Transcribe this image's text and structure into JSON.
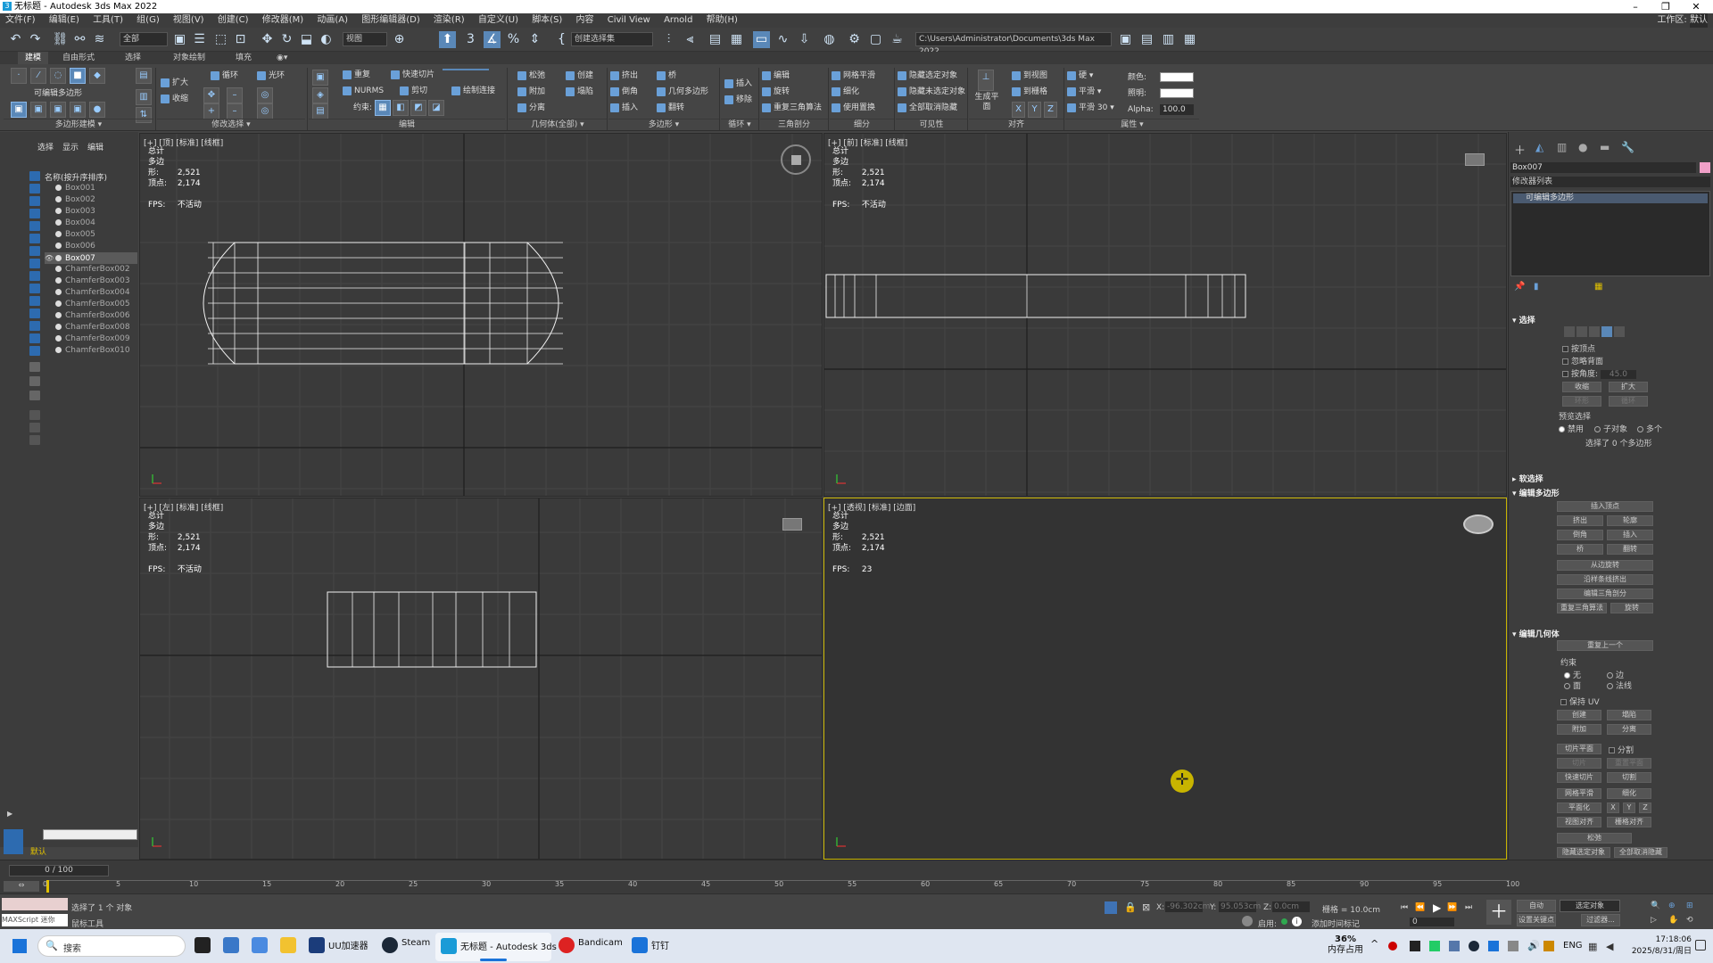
{
  "titlebar": {
    "title": "无标题 - Autodesk 3ds Max 2022",
    "logo": "3"
  },
  "menubar": {
    "items": [
      "文件(F)",
      "编辑(E)",
      "工具(T)",
      "组(G)",
      "视图(V)",
      "创建(C)",
      "修改器(M)",
      "动画(A)",
      "图形编辑器(D)",
      "渲染(R)",
      "自定义(U)",
      "脚本(S)",
      "内容",
      "Civil View",
      "Arnold",
      "帮助(H)"
    ],
    "workspace_label": "工作区:",
    "workspace_value": "默认"
  },
  "toolbar": {
    "filter": "全部",
    "view": "视图",
    "selection_set": "创建选择集",
    "project_path": "C:\\Users\\Administrator\\Documents\\3ds Max 2022"
  },
  "ribbon": {
    "tabs": [
      "建模",
      "自由形式",
      "选择",
      "对象绘制",
      "填充"
    ],
    "active_tab": "建模",
    "groups": [
      "多边形建模",
      "修改选择",
      "编辑",
      "几何体(全部)",
      "多边形",
      "循环",
      "三角剖分",
      "细分",
      "可见性",
      "对齐",
      "属性"
    ],
    "labels": {
      "editable_poly": "可编辑多边形",
      "grow": "扩大",
      "shrink": "收缩",
      "loop": "循环",
      "ring": "光环",
      "repeat": "重复",
      "quickslice": "快速切片",
      "nurms": "NURMS",
      "cut": "剪切",
      "constraint": "约束:",
      "swiftloop": "绘制连接",
      "relax": "松弛",
      "create": "创建",
      "attach": "附加",
      "collapse": "塌陷",
      "detach": "分离",
      "extrude": "挤出",
      "bridge": "桥",
      "chamfer": "倒角",
      "geopoly": "几何多边形",
      "inset": "插入",
      "flip": "翻转",
      "insert": "插入",
      "remove": "移除",
      "edit": "编辑",
      "rotate": "旋转",
      "retriangulate": "重复三角算法",
      "meshsmooth": "网格平滑",
      "tessellate": "细化",
      "usedisp": "使用置换",
      "hide_sel": "隐藏选定对象",
      "hide_unsel": "隐藏未选定对象",
      "unhide_all": "全部取消隐藏",
      "make_planar": "生成平面",
      "to_view": "到视图",
      "to_grid": "到栅格",
      "x": "X",
      "y": "Y",
      "z": "Z",
      "hard": "硬",
      "smooth": "平滑",
      "smooth30": "平滑 30",
      "color": "颜色:",
      "illum": "照明:",
      "alpha": "Alpha:",
      "alpha_val": "100.0"
    }
  },
  "scene_explorer": {
    "tabs": [
      "选择",
      "显示",
      "编辑"
    ],
    "column_header": "名称(按升序排序)",
    "objects": [
      "Box001",
      "Box002",
      "Box003",
      "Box004",
      "Box005",
      "Box006",
      "Box007",
      "ChamferBox002",
      "ChamferBox003",
      "ChamferBox004",
      "ChamferBox005",
      "ChamferBox006",
      "ChamferBox008",
      "ChamferBox009",
      "ChamferBox010"
    ],
    "selected": "Box007",
    "layer": "默认"
  },
  "viewports": {
    "top": {
      "label": "[+] [顶] [标准] [线框]",
      "fps_value": "不活动"
    },
    "front": {
      "label": "[+] [前] [标准] [线框]",
      "fps_value": "不活动"
    },
    "left": {
      "label": "[+] [左] [标准] [线框]",
      "fps_value": "不活动"
    },
    "persp": {
      "label": "[+] [透视] [标准] [边面]",
      "fps_value": "23"
    },
    "stats": {
      "total": "总计",
      "poly_label": "多边形:",
      "poly_value": "2,521",
      "vert_label": "顶点:",
      "vert_value": "2,174",
      "fps_label": "FPS:"
    }
  },
  "command_panel": {
    "object_name": "Box007",
    "modifier_list": "修改器列表",
    "stack_item": "可编辑多边形",
    "selection": {
      "title": "选择",
      "by_vertex": "按顶点",
      "ignore_back": "忽略背面",
      "by_angle": "按角度:",
      "angle_val": "45.0",
      "shrink": "收缩",
      "grow": "扩大",
      "ring": "环形",
      "loop": "循环",
      "preview": "预览选择",
      "off": "禁用",
      "subobj": "子对象",
      "multi": "多个",
      "status": "选择了 0 个多边形"
    },
    "soft_selection": "软选择",
    "edit_polygons": {
      "title": "编辑多边形",
      "insert_vertex": "插入顶点",
      "extrude": "挤出",
      "outline": "轮廓",
      "bevel": "倒角",
      "inset": "插入",
      "bridge": "桥",
      "flip": "翻转",
      "hinge": "从边旋转",
      "extrude_spline": "沿样条线挤出",
      "edit_tri": "编辑三角剖分",
      "retri": "重复三角算法",
      "turn": "旋转"
    },
    "edit_geometry": {
      "title": "编辑几何体",
      "repeat_last": "重复上一个",
      "constraints": "约束",
      "none": "无",
      "edge": "边",
      "face": "面",
      "normal": "法线",
      "preserve_uv": "保持 UV",
      "create": "创建",
      "collapse": "塌陷",
      "attach": "附加",
      "detach": "分离",
      "slice_plane": "切片平面",
      "split": "分割",
      "slice": "切片",
      "reset_plane": "重置平面",
      "quickslice": "快速切片",
      "cut": "切割",
      "meshsmooth": "网格平滑",
      "tessellate": "细化",
      "make_planar": "平面化",
      "x": "X",
      "y": "Y",
      "z": "Z",
      "view_align": "视图对齐",
      "grid_align": "栅格对齐",
      "relax": "松弛",
      "hide_sel": "隐藏选定对象",
      "unhide_all": "全部取消隐藏"
    }
  },
  "timeline": {
    "frame": "0 / 100",
    "ticks": [
      "0",
      "5",
      "10",
      "15",
      "20",
      "25",
      "30",
      "35",
      "40",
      "45",
      "50",
      "55",
      "60",
      "65",
      "70",
      "75",
      "80",
      "85",
      "90",
      "95",
      "100"
    ]
  },
  "status": {
    "maxscript": "MAXScript 迷你",
    "selected": "选择了 1 个 对象",
    "prompt": "鼠标工具",
    "x_label": "X:",
    "x_value": "-96.302cm",
    "y_label": "Y:",
    "y_value": "95.053cm",
    "z_label": "Z:",
    "z_value": "0.0cm",
    "grid": "栅格 = 10.0cm",
    "autokey": "自动",
    "setkey": "设置关键点",
    "sel_obj": "选定对象",
    "key_filter": "过滤器...",
    "enable": "启用:",
    "add_time_tag": "添加时间标记",
    "frame_val": "0"
  },
  "taskbar": {
    "search": "搜索",
    "apps": [
      "UU加速器",
      "Steam",
      "无标题 - Autodesk 3ds M",
      "Bandicam",
      "钉钉"
    ],
    "memory_pct": "36%",
    "memory_label": "内存占用",
    "lang": "ENG",
    "time": "17:18:06",
    "date": "2025/8/31/周日"
  }
}
